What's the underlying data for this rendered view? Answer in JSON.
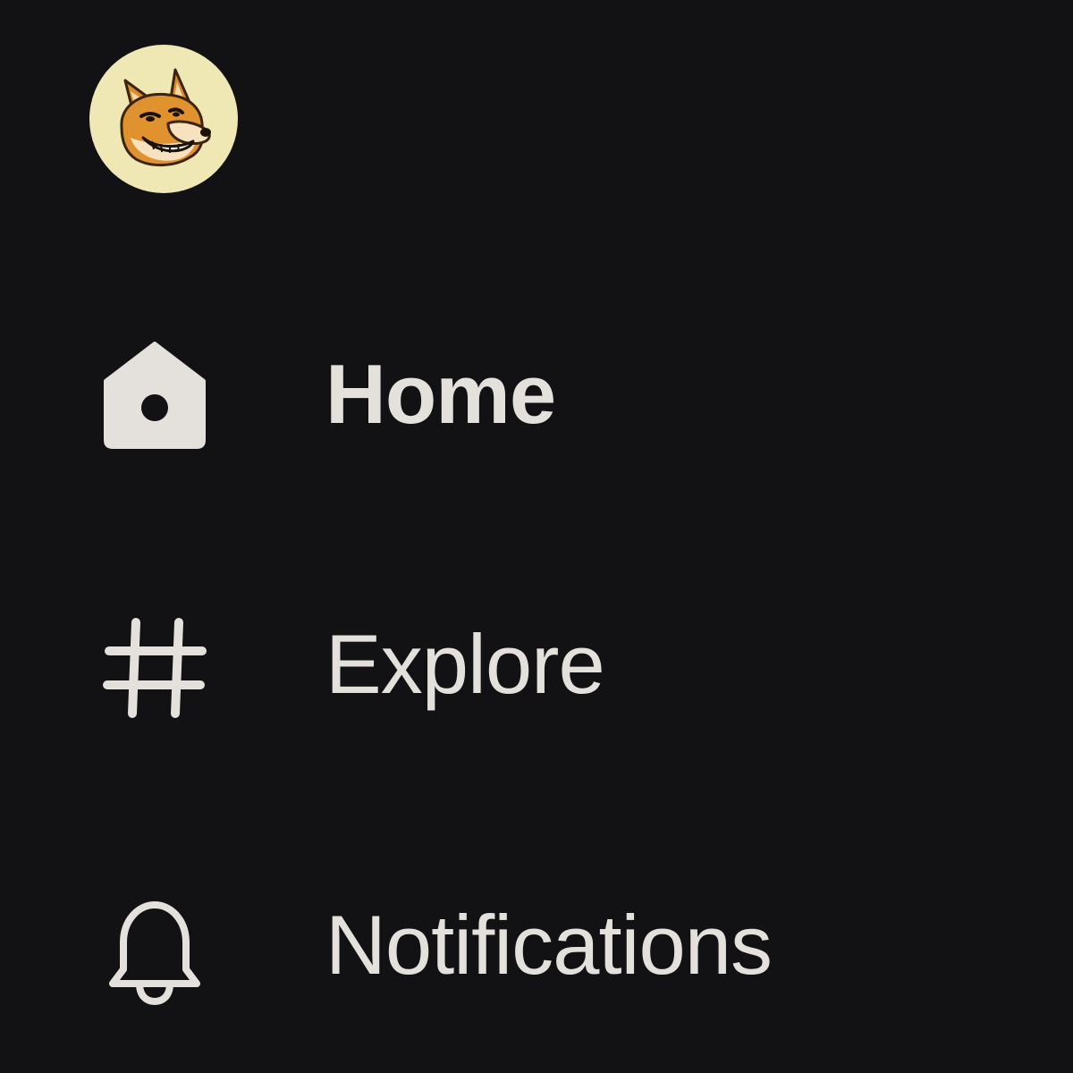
{
  "profile": {
    "avatar_icon": "shiba-dog-avatar",
    "avatar_bg": "#efe8b4"
  },
  "nav": {
    "items": [
      {
        "label": "Home",
        "icon": "home-icon",
        "active": true
      },
      {
        "label": "Explore",
        "icon": "hashtag-icon",
        "active": false
      },
      {
        "label": "Notifications",
        "icon": "bell-icon",
        "active": false
      }
    ]
  },
  "colors": {
    "background": "#121114",
    "text": "#e4e1dc"
  }
}
